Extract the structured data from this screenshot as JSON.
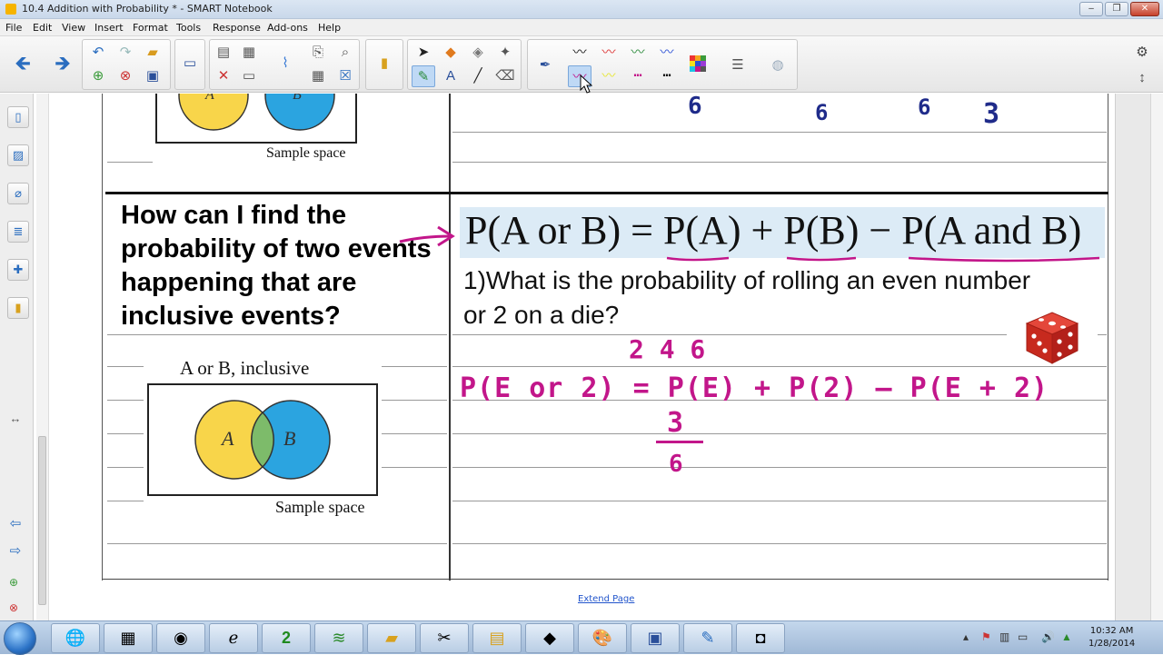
{
  "window": {
    "title": "10.4 Addition with Probability * - SMART Notebook"
  },
  "menu": [
    "File",
    "Edit",
    "View",
    "Insert",
    "Format",
    "Tools",
    "Response",
    "Add-ons",
    "Help"
  ],
  "page": {
    "top_section": {
      "sample_space_label": "Sample space",
      "circle_a": "A",
      "circle_b": "B"
    },
    "question": "How can I find the probability of two events happening that are inclusive events?",
    "formula": "P(A or B) = P(A) + P(B) − P(A and B)",
    "problem": "1)What is the probability of rolling an even number or 2 on a die?",
    "venn": {
      "title": "A or B, inclusive",
      "circle_a": "A",
      "circle_b": "B",
      "sample_space_label": "Sample space"
    },
    "handwriting": {
      "top_numbers": [
        "6",
        "6",
        "6",
        "3"
      ],
      "evens": "2 4 6",
      "equation": "P(E or 2) = P(E) + P(2) — P(E + 2)",
      "numerator": "3",
      "denominator": "6"
    },
    "extend_page": "Extend Page"
  },
  "taskbar": {
    "time": "10:32 AM",
    "date": "1/28/2014"
  },
  "colors": {
    "ink_magenta": "#c2168a",
    "ink_blue": "#1f2b8a",
    "circle_a": "#f8d54a",
    "circle_b": "#2ba4e0",
    "overlap": "#7dbb6a",
    "formula_highlight": "#dcebf6"
  }
}
